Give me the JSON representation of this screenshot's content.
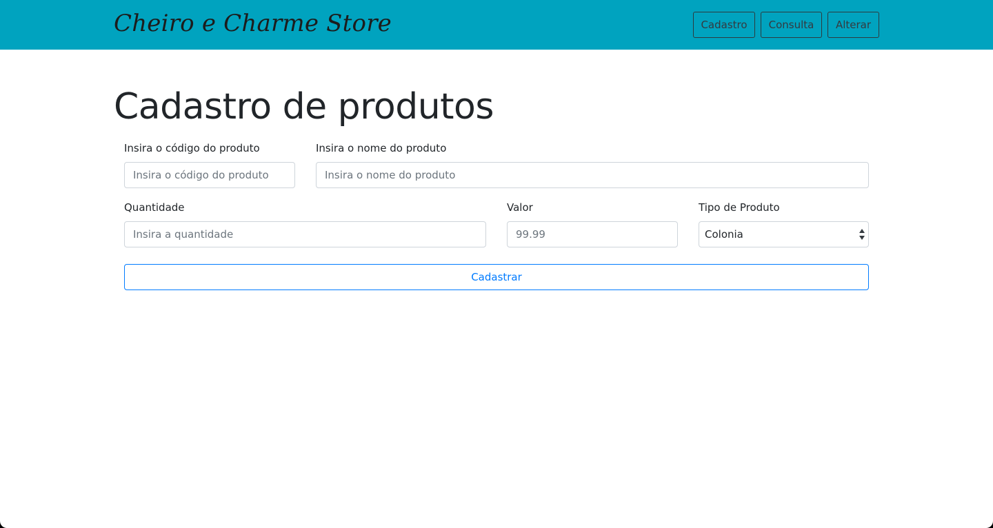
{
  "navbar": {
    "brand": "Cheiro e Charme Store",
    "links": [
      {
        "label": "Cadastro"
      },
      {
        "label": "Consulta"
      },
      {
        "label": "Alterar"
      }
    ]
  },
  "page": {
    "title": "Cadastro de produtos"
  },
  "form": {
    "codigo": {
      "label": "Insira o código do produto",
      "placeholder": "Insira o código do produto",
      "value": ""
    },
    "nome": {
      "label": "Insira o nome do produto",
      "placeholder": "Insira o nome do produto",
      "value": ""
    },
    "quantidade": {
      "label": "Quantidade",
      "placeholder": "Insira a quantidade",
      "value": ""
    },
    "valor": {
      "label": "Valor",
      "placeholder": "99.99",
      "value": ""
    },
    "tipo": {
      "label": "Tipo de Produto",
      "selected": "Colonia"
    },
    "submit_label": "Cadastrar"
  },
  "colors": {
    "navbar_bg": "#00a3bf",
    "primary": "#007bff"
  }
}
